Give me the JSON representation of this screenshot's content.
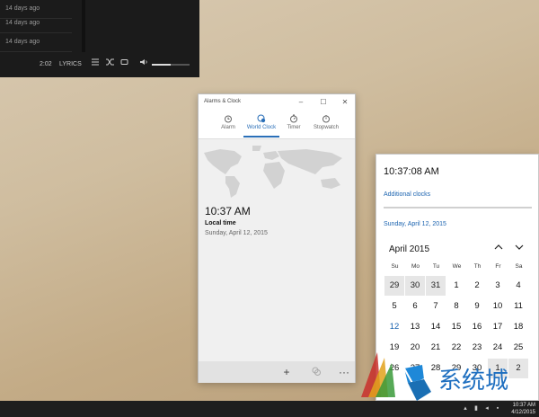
{
  "player": {
    "rows": [
      "14 days ago",
      "14 days ago",
      "14 days ago"
    ],
    "elapsed": "2:02",
    "lyrics_label": "LYRICS",
    "volume_fraction": 0.5
  },
  "alarms_window": {
    "title": "Alarms & Clock",
    "tabs": [
      {
        "label": "Alarm",
        "icon": "alarm-icon",
        "active": false
      },
      {
        "label": "World Clock",
        "icon": "world-clock-icon",
        "active": true
      },
      {
        "label": "Timer",
        "icon": "timer-icon",
        "active": false
      },
      {
        "label": "Stopwatch",
        "icon": "stopwatch-icon",
        "active": false
      }
    ],
    "time": "10:37 AM",
    "location_label": "Local time",
    "date": "Sunday, April 12, 2015"
  },
  "flyout": {
    "time": "10:37:08 AM",
    "additional_clocks": "Additional clocks",
    "date_link": "Sunday, April 12, 2015",
    "month_label": "April 2015",
    "weekdays": [
      "Su",
      "Mo",
      "Tu",
      "We",
      "Th",
      "Fr",
      "Sa"
    ],
    "weeks": [
      [
        "29",
        "30",
        "31",
        "1",
        "2",
        "3",
        "4"
      ],
      [
        "5",
        "6",
        "7",
        "8",
        "9",
        "10",
        "11"
      ],
      [
        "12",
        "13",
        "14",
        "15",
        "16",
        "17",
        "18"
      ],
      [
        "19",
        "20",
        "21",
        "22",
        "23",
        "24",
        "25"
      ],
      [
        "26",
        "27",
        "28",
        "29",
        "30",
        "1",
        "2"
      ]
    ],
    "today": "12",
    "accent": "#1c64b0"
  },
  "taskbar": {
    "time": "10:37 AM",
    "date": "4/12/2015"
  },
  "watermark": {
    "brand_text": "系统城"
  }
}
